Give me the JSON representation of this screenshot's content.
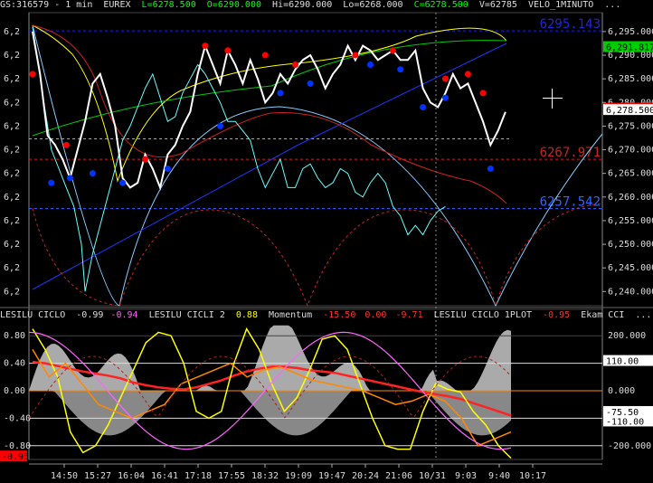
{
  "header": {
    "symbol": "GS:316579 - 1 min",
    "exchange": "EUREX",
    "last": "L=6278.500",
    "open": "O=6290.000",
    "high": "Hi=6290.000",
    "low": "Lo=6268.000",
    "close": "C=6278.500",
    "volume": "V=62785",
    "study": "VELO_1MINUTO",
    "more": "..."
  },
  "indicator_header": {
    "ciclo_name": "LESILU CICLO",
    "ciclo_val": "-0.99",
    "ciclo_val2": "-0.94",
    "ciclo2_name": "LESILU CICLI 2",
    "ciclo2_val": "0.88",
    "momentum_name": "Momentum",
    "momentum_vals": "-15.50",
    "momentum_val2": "0.00",
    "momentum_val3": "-9.71",
    "plot_name": "LESILU CICLO 1PLOT",
    "plot_val": "-0.95",
    "cci_name": "Ekam CCI",
    "more": "..."
  },
  "chart_data": [
    {
      "type": "line",
      "title": "GS:316579 - 1 min",
      "y_axis_side": "right",
      "y_ticks": [
        "6,295.000",
        "6,290.000",
        "6,285.000",
        "6,280.000",
        "6,275.000",
        "6,270.000",
        "6,265.000",
        "6,260.000",
        "6,255.000",
        "6,250.000",
        "6,245.000",
        "6,240.000"
      ],
      "ylim": [
        6237,
        6299
      ],
      "left_axis_labels": [
        "6,2",
        "6,2",
        "6,2",
        "6,2",
        "6,2",
        "6,2",
        "6,2",
        "6,2",
        "6,2",
        "6,2",
        "6,2",
        "6,2"
      ],
      "price_tags": [
        {
          "label": "6,291.817",
          "value": 6291.817,
          "color": "#00cc00"
        },
        {
          "label": "6,278.717",
          "value": 6278.8,
          "color": "#ff0000"
        },
        {
          "label": "6,278.500",
          "value": 6278.5,
          "color": "#ffffff"
        }
      ],
      "levels": [
        {
          "label": "6295.143",
          "value": 6295.143,
          "color": "#2222dd"
        },
        {
          "label": "6267.971",
          "value": 6267.971,
          "color": "#cc2222"
        },
        {
          "label": "6257.542",
          "value": 6257.542,
          "color": "#3366ff"
        }
      ],
      "price_hhmm": [
        [
          0,
          6295
        ],
        [
          2,
          6286
        ],
        [
          4,
          6273
        ],
        [
          6,
          6271
        ],
        [
          8,
          6268
        ],
        [
          10,
          6264
        ],
        [
          12,
          6270
        ],
        [
          14,
          6276
        ],
        [
          16,
          6284
        ],
        [
          18,
          6286
        ],
        [
          20,
          6281
        ],
        [
          22,
          6275
        ],
        [
          24,
          6264
        ],
        [
          26,
          6262
        ],
        [
          28,
          6263
        ],
        [
          30,
          6269
        ],
        [
          32,
          6266
        ],
        [
          34,
          6262
        ],
        [
          36,
          6269
        ],
        [
          38,
          6271
        ],
        [
          40,
          6275
        ],
        [
          42,
          6278
        ],
        [
          44,
          6286
        ],
        [
          46,
          6292
        ],
        [
          48,
          6288
        ],
        [
          50,
          6284
        ],
        [
          52,
          6291
        ],
        [
          54,
          6288
        ],
        [
          56,
          6284
        ],
        [
          58,
          6289
        ],
        [
          60,
          6285
        ],
        [
          62,
          6280
        ],
        [
          64,
          6282
        ],
        [
          66,
          6286
        ],
        [
          68,
          6284
        ],
        [
          70,
          6287
        ],
        [
          72,
          6289
        ],
        [
          74,
          6290
        ],
        [
          76,
          6287
        ],
        [
          78,
          6283
        ],
        [
          80,
          6286
        ],
        [
          82,
          6288
        ],
        [
          84,
          6292
        ],
        [
          86,
          6289
        ],
        [
          88,
          6292
        ],
        [
          90,
          6291
        ],
        [
          92,
          6289
        ],
        [
          94,
          6290
        ],
        [
          96,
          6291
        ],
        [
          98,
          6289
        ],
        [
          100,
          6289
        ],
        [
          102,
          6291
        ],
        [
          104,
          6283
        ],
        [
          106,
          6280
        ],
        [
          108,
          6279
        ],
        [
          110,
          6282
        ],
        [
          112,
          6286
        ],
        [
          114,
          6283
        ],
        [
          116,
          6284
        ],
        [
          118,
          6280
        ],
        [
          120,
          6276
        ],
        [
          122,
          6271
        ],
        [
          124,
          6274
        ],
        [
          126,
          6278
        ]
      ],
      "cyan_hhmm": [
        [
          0,
          6296
        ],
        [
          3,
          6280
        ],
        [
          5,
          6270
        ],
        [
          7,
          6266
        ],
        [
          9,
          6262
        ],
        [
          11,
          6258
        ],
        [
          13,
          6250
        ],
        [
          14,
          6240
        ],
        [
          16,
          6248
        ],
        [
          18,
          6254
        ],
        [
          20,
          6260
        ],
        [
          22,
          6266
        ],
        [
          24,
          6272
        ],
        [
          26,
          6275
        ],
        [
          28,
          6279
        ],
        [
          30,
          6283
        ],
        [
          32,
          6286
        ],
        [
          34,
          6281
        ],
        [
          36,
          6276
        ],
        [
          38,
          6277
        ],
        [
          40,
          6282
        ],
        [
          42,
          6285
        ],
        [
          44,
          6288
        ],
        [
          46,
          6286
        ],
        [
          48,
          6283
        ],
        [
          50,
          6280
        ],
        [
          52,
          6276
        ],
        [
          54,
          6276
        ],
        [
          56,
          6274
        ],
        [
          58,
          6272
        ],
        [
          60,
          6266
        ],
        [
          62,
          6262
        ],
        [
          64,
          6265
        ],
        [
          66,
          6268
        ],
        [
          68,
          6262
        ],
        [
          70,
          6262
        ],
        [
          72,
          6266
        ],
        [
          74,
          6267
        ],
        [
          76,
          6264
        ],
        [
          78,
          6262
        ],
        [
          80,
          6263
        ],
        [
          82,
          6266
        ],
        [
          84,
          6265
        ],
        [
          86,
          6261
        ],
        [
          88,
          6260
        ],
        [
          90,
          6263
        ],
        [
          92,
          6265
        ],
        [
          94,
          6263
        ],
        [
          96,
          6258
        ],
        [
          98,
          6256
        ],
        [
          100,
          6252
        ],
        [
          102,
          6254
        ],
        [
          104,
          6252
        ],
        [
          106,
          6255
        ],
        [
          108,
          6257
        ],
        [
          110,
          6258
        ]
      ],
      "time_ticks": [
        "14:50",
        "15:27",
        "16:04",
        "16:41",
        "17:18",
        "17:55",
        "18:32",
        "19:09",
        "19:47",
        "20:24",
        "21:06",
        "10/31",
        "9:03",
        "9:40",
        "10:17"
      ],
      "grid": false
    },
    {
      "type": "line",
      "title": "LESILU CICLO",
      "y_ticks_left": [
        "0.80",
        "0.40",
        "0.00",
        "-0.40",
        "-0.80"
      ],
      "y_ticks_right": [
        "200.000",
        "100.000",
        "0.000",
        "-100.000",
        "-200.000"
      ],
      "ylim_left": [
        -1.0,
        1.0
      ],
      "right_tags": [
        {
          "label": "110.00",
          "value": 110
        },
        {
          "label": "-75.50",
          "value": -75.5
        },
        {
          "label": "-110.00",
          "value": -110
        }
      ],
      "left_tag": {
        "label": "-0.95",
        "value": -0.95
      },
      "series": [
        {
          "name": "LESILU CICLO",
          "color": "#ff2222",
          "values": [
            0.42,
            0.4,
            0.36,
            0.32,
            0.28,
            0.25,
            0.22,
            0.18,
            0.12,
            0.08,
            0.05,
            0.03,
            0.02,
            0.05,
            0.1,
            0.15,
            0.22,
            0.28,
            0.32,
            0.35,
            0.35,
            0.33,
            0.3,
            0.28,
            0.26,
            0.22,
            0.18,
            0.14,
            0.1,
            0.06,
            0.02,
            -0.02,
            -0.05,
            -0.08,
            -0.12,
            -0.18,
            -0.24,
            -0.3,
            -0.36
          ]
        },
        {
          "name": "LESILU CICLI 2",
          "color": "#ffff00",
          "values": [
            0.9,
            0.6,
            0.2,
            -0.6,
            -0.9,
            -0.8,
            -0.5,
            -0.1,
            0.3,
            0.7,
            0.85,
            0.8,
            0.4,
            -0.3,
            -0.4,
            -0.3,
            0.4,
            0.9,
            0.6,
            0.1,
            -0.3,
            -0.1,
            0.3,
            0.75,
            0.8,
            0.6,
            0.1,
            -0.4,
            -0.8,
            -0.85,
            -0.85,
            -0.3,
            0.1,
            0.02,
            -0.02,
            -0.3,
            -0.5,
            -0.8,
            -0.98
          ]
        },
        {
          "name": "Momentum",
          "color": "#ff8800",
          "values": [
            0.6,
            0.2,
            0.4,
            0.1,
            -0.2,
            -0.3,
            -0.4,
            -0.3,
            -0.2,
            0.1,
            0.2,
            0.3,
            0.4,
            0.2,
            0.3,
            0.35,
            0.25,
            0.15,
            0.1,
            0.05,
            0.0,
            -0.1,
            -0.2,
            -0.15,
            -0.05,
            -0.15,
            -0.4,
            -0.8,
            -0.7,
            -0.6
          ]
        }
      ]
    }
  ]
}
